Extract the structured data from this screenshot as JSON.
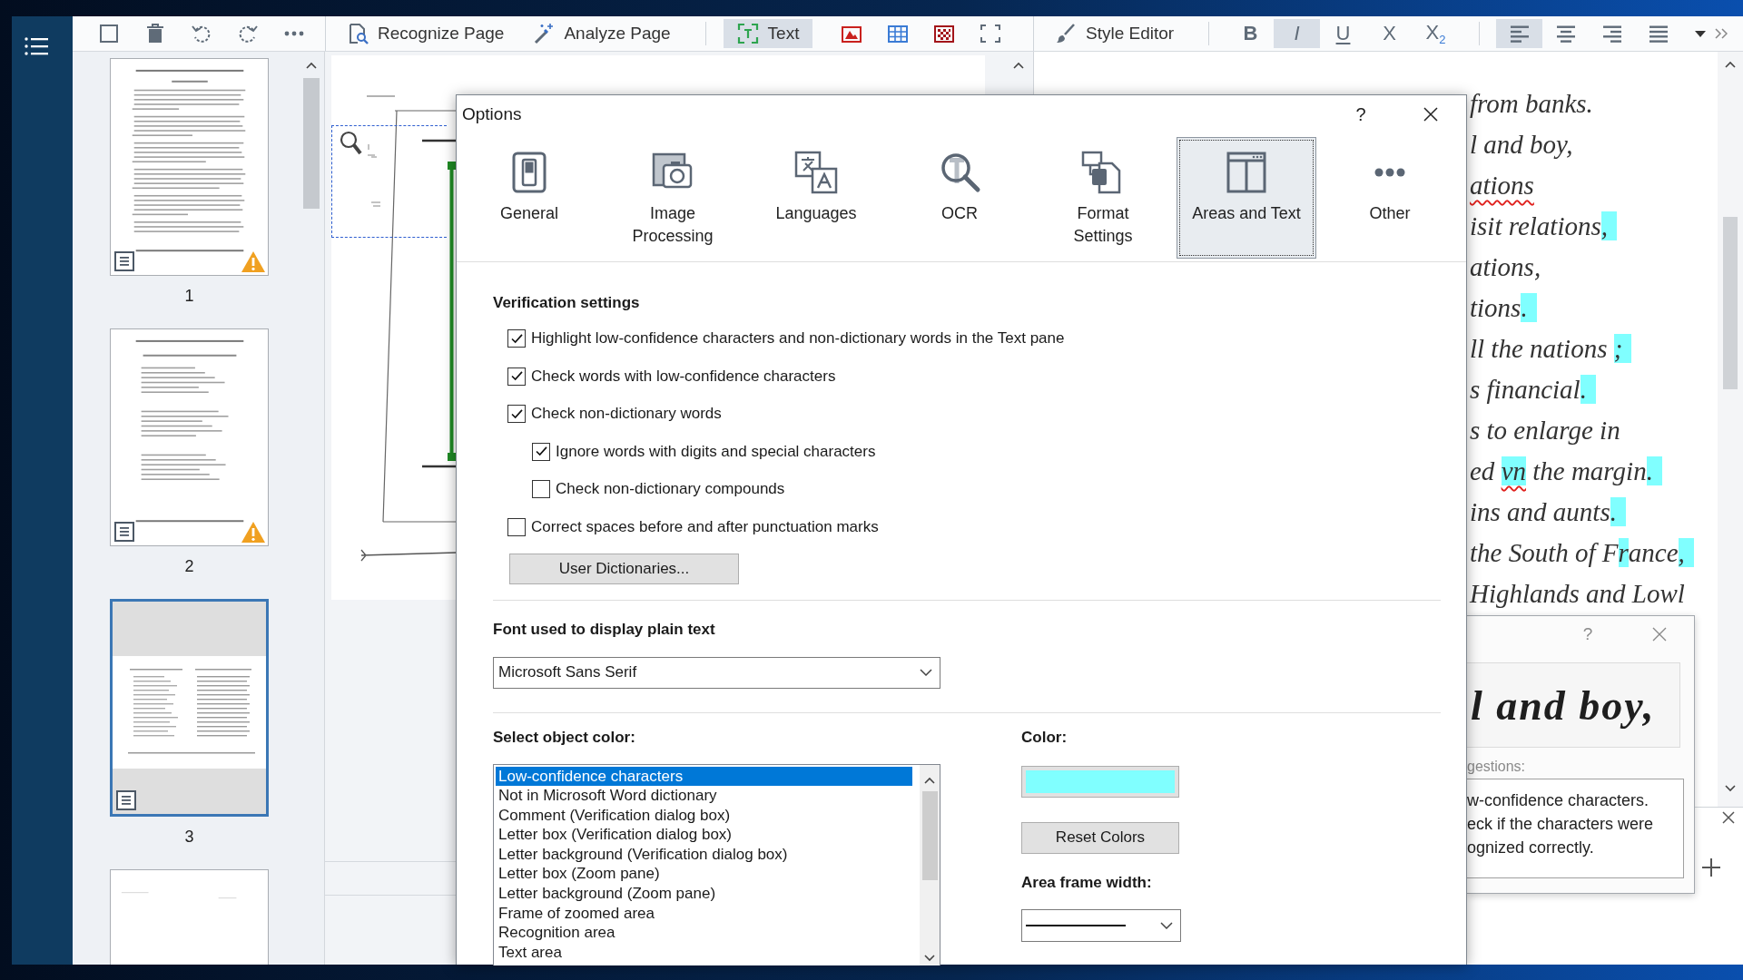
{
  "toolbar": {
    "recognize_page": "Recognize Page",
    "analyze_page": "Analyze Page",
    "area_tools": [
      {
        "label": "Text",
        "selected": true
      },
      {
        "selected": false
      },
      {
        "selected": false
      },
      {
        "selected": false
      },
      {
        "selected": false
      }
    ],
    "style_editor": "Style Editor",
    "format_buttons": [
      {
        "label": "B",
        "selected": false
      },
      {
        "label": "I",
        "selected": true
      },
      {
        "label": "U",
        "selected": false
      },
      {
        "label": "X",
        "selected": false
      },
      {
        "label": "X$_{2}$",
        "selected": false
      }
    ],
    "align_buttons": [
      {
        "selected": true
      },
      {
        "selected": false
      },
      {
        "selected": false
      },
      {
        "selected": false
      }
    ]
  },
  "thumbnails": [
    {
      "label": "1",
      "kind": "page",
      "selected": false,
      "text_icon": true,
      "warning": true
    },
    {
      "label": "2",
      "kind": "page",
      "selected": false,
      "text_icon": true,
      "warning": true
    },
    {
      "label": "3",
      "kind": "spread",
      "selected": true,
      "text_icon": true,
      "warning": false
    },
    {
      "kind": "partial",
      "selected": false,
      "text_icon": false,
      "warning": false
    }
  ],
  "text_pane": {
    "lines": [
      {
        "segments": [
          {
            "text": "from banks.",
            "highlighted": false,
            "underlined": false
          }
        ]
      },
      {
        "segments": [
          {
            "text": "l and boy,",
            "highlighted": false,
            "underlined": false
          }
        ]
      },
      {
        "segments": [
          {
            "text": "ations",
            "highlighted": false,
            "underlined": true
          }
        ]
      },
      {
        "segments": [
          {
            "text": "isit relations",
            "highlighted": false,
            "underlined": false
          },
          {
            "text": ",",
            "highlighted": true,
            "underlined": false
          }
        ]
      },
      {
        "segments": [
          {
            "text": "ations,",
            "highlighted": false,
            "underlined": false
          }
        ]
      },
      {
        "segments": [
          {
            "text": "tions",
            "highlighted": false,
            "underlined": false
          },
          {
            "text": ".",
            "highlighted": true,
            "underlined": false
          }
        ]
      },
      {
        "segments": [
          {
            "text": "ll the nations ",
            "highlighted": false,
            "underlined": false
          },
          {
            "text": ";",
            "highlighted": true,
            "underlined": false
          }
        ]
      },
      {
        "segments": [
          {
            "text": "s financial",
            "highlighted": false,
            "underlined": false
          },
          {
            "text": ".",
            "highlighted": true,
            "underlined": false
          }
        ]
      },
      {
        "segments": [
          {
            "text": "s to enlarge in",
            "highlighted": false,
            "underlined": false
          }
        ]
      },
      {
        "segments": [
          {
            "text": "ed ",
            "highlighted": false,
            "underlined": false
          },
          {
            "text": "vn",
            "highlighted": true,
            "underlined": true
          },
          {
            "text": " the margin",
            "highlighted": false,
            "underlined": false
          },
          {
            "text": ".",
            "highlighted": true,
            "underlined": false
          }
        ]
      },
      {
        "segments": [
          {
            "text": "ins and aunts",
            "highlighted": false,
            "underlined": false
          },
          {
            "text": ".",
            "highlighted": true,
            "underlined": false
          }
        ]
      },
      {
        "segments": [
          {
            "text": "the South of F",
            "highlighted": false,
            "underlined": false
          },
          {
            "text": "r",
            "highlighted": true,
            "underlined": false
          },
          {
            "text": "ance",
            "highlighted": false,
            "underlined": false
          },
          {
            "text": ",",
            "highlighted": true,
            "underlined": false
          }
        ]
      },
      {
        "segments": [
          {
            "text": "Highlands and Lowl",
            "highlighted": false,
            "underlined": false
          }
        ]
      }
    ]
  },
  "options_dialog": {
    "title": "Options",
    "help": "?",
    "tabs": [
      {
        "label": "General",
        "selected": false
      },
      {
        "label": "Image\nProcessing",
        "selected": false
      },
      {
        "label": "Languages",
        "selected": false
      },
      {
        "label": "OCR",
        "selected": false
      },
      {
        "label": "Format\nSettings",
        "selected": false
      },
      {
        "label": "Areas and Text",
        "selected": true
      },
      {
        "label": "Other",
        "selected": false
      }
    ],
    "verification": {
      "heading": "Verification settings",
      "options": [
        {
          "label": "Highlight low-confidence characters and non-dictionary words in the Text pane",
          "checked": true
        },
        {
          "label": "Check words with low-confidence characters",
          "checked": true
        },
        {
          "label": "Check non-dictionary words",
          "checked": true,
          "children": [
            {
              "label": "Ignore words with digits and special characters",
              "checked": true
            },
            {
              "label": "Check non-dictionary compounds",
              "checked": false
            }
          ]
        },
        {
          "label": "Correct spaces before and after punctuation marks",
          "checked": false
        }
      ],
      "button": "User Dictionaries..."
    },
    "font": {
      "heading": "Font used to display plain text",
      "value": "Microsoft Sans Serif"
    },
    "colors": {
      "heading": "Select object color:",
      "items": [
        {
          "label": "Low-confidence characters",
          "selected": true
        },
        {
          "label": "Not in Microsoft Word dictionary",
          "selected": false
        },
        {
          "label": "Comment (Verification dialog box)",
          "selected": false
        },
        {
          "label": "Letter box (Verification dialog box)",
          "selected": false
        },
        {
          "label": "Letter background (Verification dialog box)",
          "selected": false
        },
        {
          "label": "Letter box (Zoom pane)",
          "selected": false
        },
        {
          "label": "Letter background (Zoom pane)",
          "selected": false
        },
        {
          "label": "Frame of zoomed area",
          "selected": false
        },
        {
          "label": "Recognition area",
          "selected": false
        },
        {
          "label": "Text area",
          "selected": false
        }
      ],
      "color_heading": "Color:",
      "color": "#80ffff",
      "reset_button": "Reset Colors",
      "frame_heading": "Area frame width:"
    }
  },
  "verification_dialog": {
    "help": "?",
    "preview_text": "l and boy,",
    "suggestions_label": "gestions:",
    "message_lines": [
      "w-confidence characters.",
      "eck if the characters were",
      "ognized correctly."
    ]
  }
}
